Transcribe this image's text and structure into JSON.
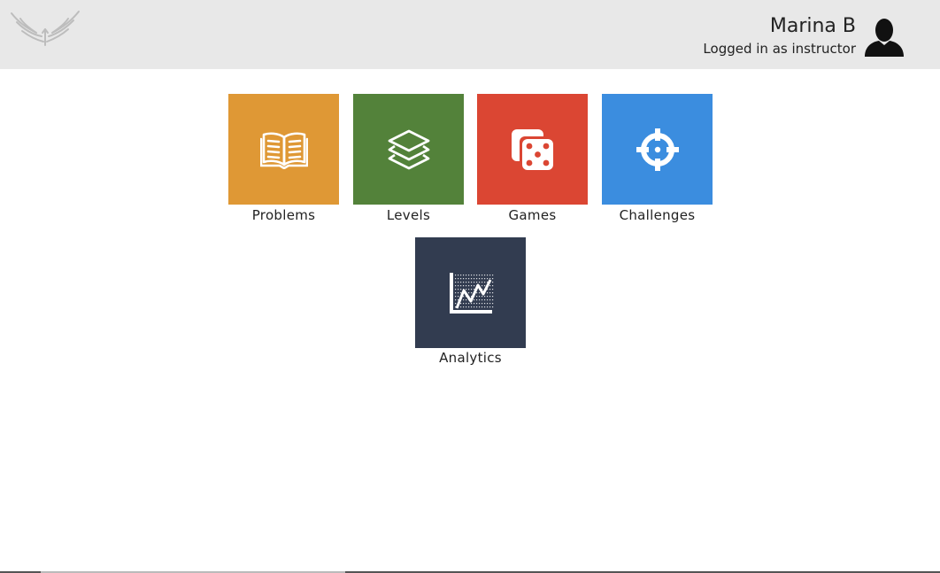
{
  "header": {
    "user_name": "Marina B",
    "user_role": "Logged in as instructor",
    "logo_icon": "wings-logo-icon",
    "avatar_icon": "user-silhouette-icon",
    "background": "#e8e8e8"
  },
  "tiles": [
    {
      "label": "Problems",
      "icon": "open-book-icon",
      "color": "#df9835"
    },
    {
      "label": "Levels",
      "icon": "layers-icon",
      "color": "#53823a"
    },
    {
      "label": "Games",
      "icon": "dice-icon",
      "color": "#db4633"
    },
    {
      "label": "Challenges",
      "icon": "crosshair-target-icon",
      "color": "#3b8ddf"
    },
    {
      "label": "Analytics",
      "icon": "line-chart-icon",
      "color": "#323c50"
    }
  ]
}
